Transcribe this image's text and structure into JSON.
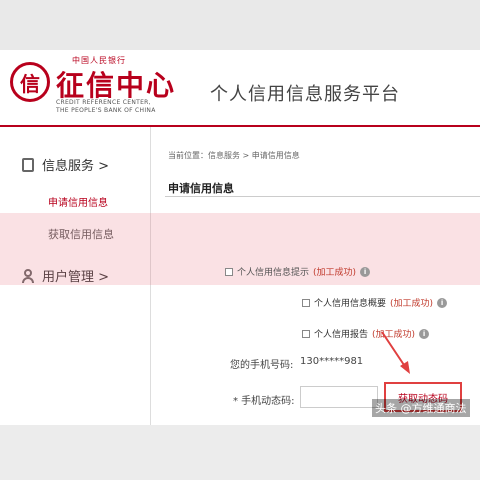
{
  "header": {
    "logo_top": "中国人民银行",
    "logo_main": "征信中心",
    "logo_sub1": "CREDIT REFERENCE CENTER,",
    "logo_sub2": "THE PEOPLE'S BANK OF CHINA",
    "platform_title": "个人信用信息服务平台"
  },
  "sidebar": {
    "section1": {
      "label": "信息服务 >",
      "icon": "document-icon"
    },
    "items": [
      {
        "label": "申请信用信息",
        "active": true
      },
      {
        "label": "获取信用信息",
        "active": false
      }
    ],
    "section2": {
      "label": "用户管理 >",
      "icon": "user-icon"
    }
  },
  "main": {
    "breadcrumb": "当前位置：信息服务 > 申请信用信息",
    "title": "申请信用信息",
    "options": [
      {
        "label": "个人信用信息提示",
        "status": "(加工成功)"
      },
      {
        "label": "个人信用信息概要",
        "status": "(加工成功)"
      },
      {
        "label": "个人信用报告",
        "status": "(加工成功)"
      }
    ],
    "phone_label": "您的手机号码:",
    "phone_value": "130*****981",
    "code_label": "* 手机动态码:",
    "code_value": "",
    "get_code_button": "获取动态码"
  },
  "watermark": "头条 @方维通商法",
  "colors": {
    "brand": "#b8001c",
    "status": "#c0392b",
    "highlight": "#e6788238"
  }
}
